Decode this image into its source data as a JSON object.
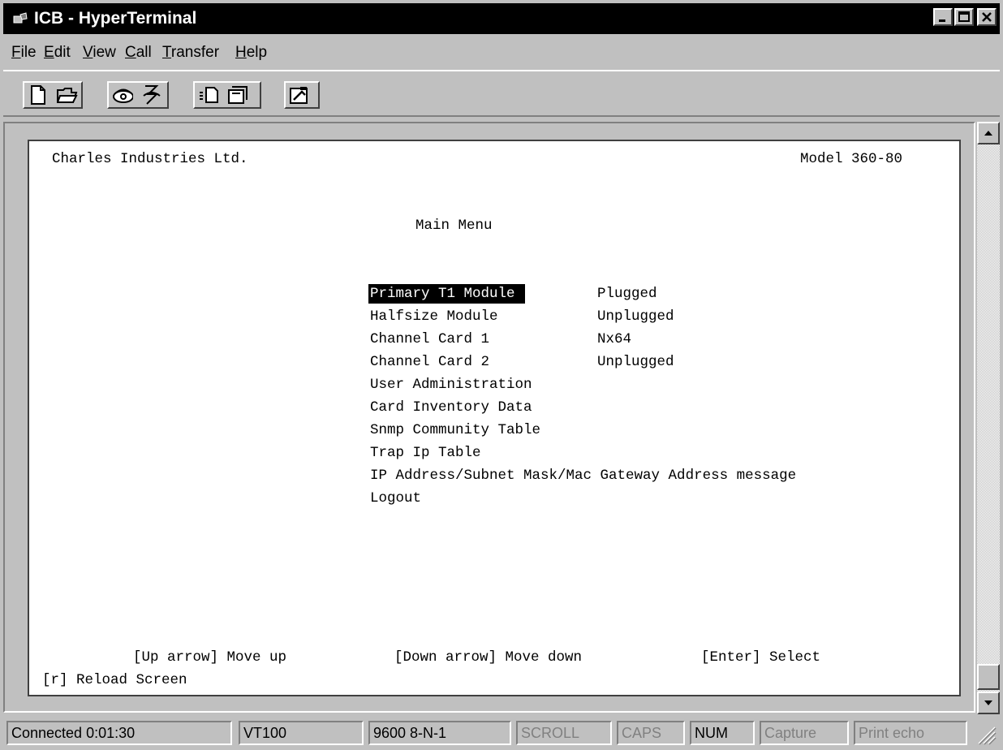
{
  "window": {
    "title": "ICB - HyperTerminal",
    "icon": "hyperterminal-app-icon"
  },
  "menubar": [
    "File",
    "Edit",
    "View",
    "Call",
    "Transfer",
    "Help"
  ],
  "toolbar": {
    "icons": [
      "new-icon",
      "open-icon",
      "connect-icon",
      "disconnect-icon",
      "send-icon",
      "receive-icon",
      "properties-icon"
    ]
  },
  "terminal": {
    "company": "Charles Industries Ltd.",
    "model": "Model 360-80",
    "menu_title": "Main Menu",
    "items": [
      {
        "label": "Primary T1 Module ",
        "status": "Plugged"
      },
      {
        "label": "Halfsize Module",
        "status": "Unplugged"
      },
      {
        "label": "Channel Card 1",
        "status": "Nx64"
      },
      {
        "label": "Channel Card 2",
        "status": "Unplugged"
      },
      {
        "label": "User Administration",
        "status": ""
      },
      {
        "label": "Card Inventory Data",
        "status": ""
      },
      {
        "label": "Snmp Community Table",
        "status": ""
      },
      {
        "label": "Trap Ip Table",
        "status": ""
      },
      {
        "label": "IP Address/Subnet Mask/Mac Gateway Address message",
        "status": ""
      },
      {
        "label": "Logout",
        "status": ""
      }
    ],
    "help_up": "[Up arrow] Move up",
    "help_down": "[Down arrow] Move down",
    "help_enter": "[Enter] Select",
    "help_reload": "[r] Reload Screen"
  },
  "statusbar": {
    "connected": "Connected 0:01:30",
    "emulation": "VT100",
    "port_settings": "9600 8-N-1",
    "scroll": "SCROLL",
    "caps": "CAPS",
    "num": "NUM",
    "capture": "Capture",
    "print_echo": "Print echo"
  },
  "colors": {
    "titlebar": "#000000",
    "chrome": "#c0c0c0",
    "highlight": "#000000"
  }
}
